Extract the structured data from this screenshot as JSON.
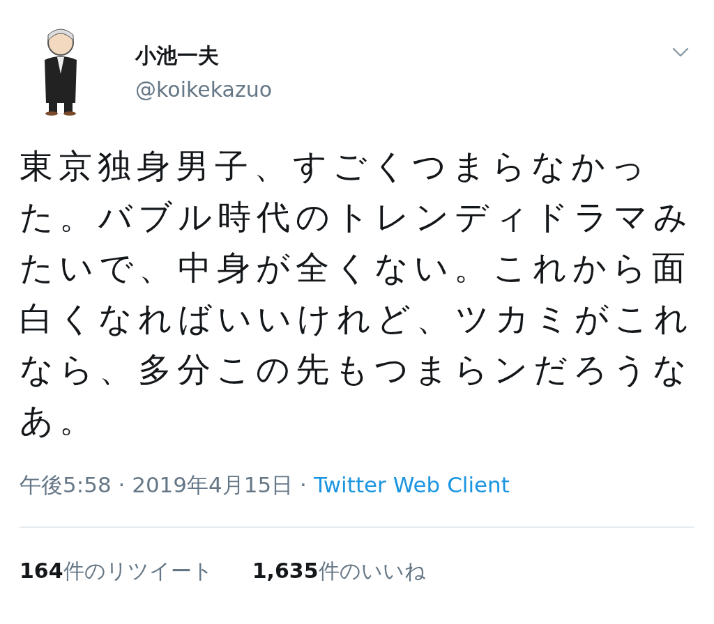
{
  "tweet": {
    "author": {
      "name": "小池一夫",
      "handle": "@koikekazuo"
    },
    "text": "東京独身男子、すごくつまらなかった。バブル時代のトレンディドラマみたいで、中身が全くない。これから面白くなればいいけれど、ツカミがこれなら、多分この先もつまらンだろうなあ。",
    "timestamp": "午後5:58 · 2019年4月15日 ·",
    "source": "Twitter Web Client",
    "stats": [
      {
        "count": "164",
        "label": "件のリツイート"
      },
      {
        "count": "1,635",
        "label": "件のいいね"
      }
    ]
  }
}
